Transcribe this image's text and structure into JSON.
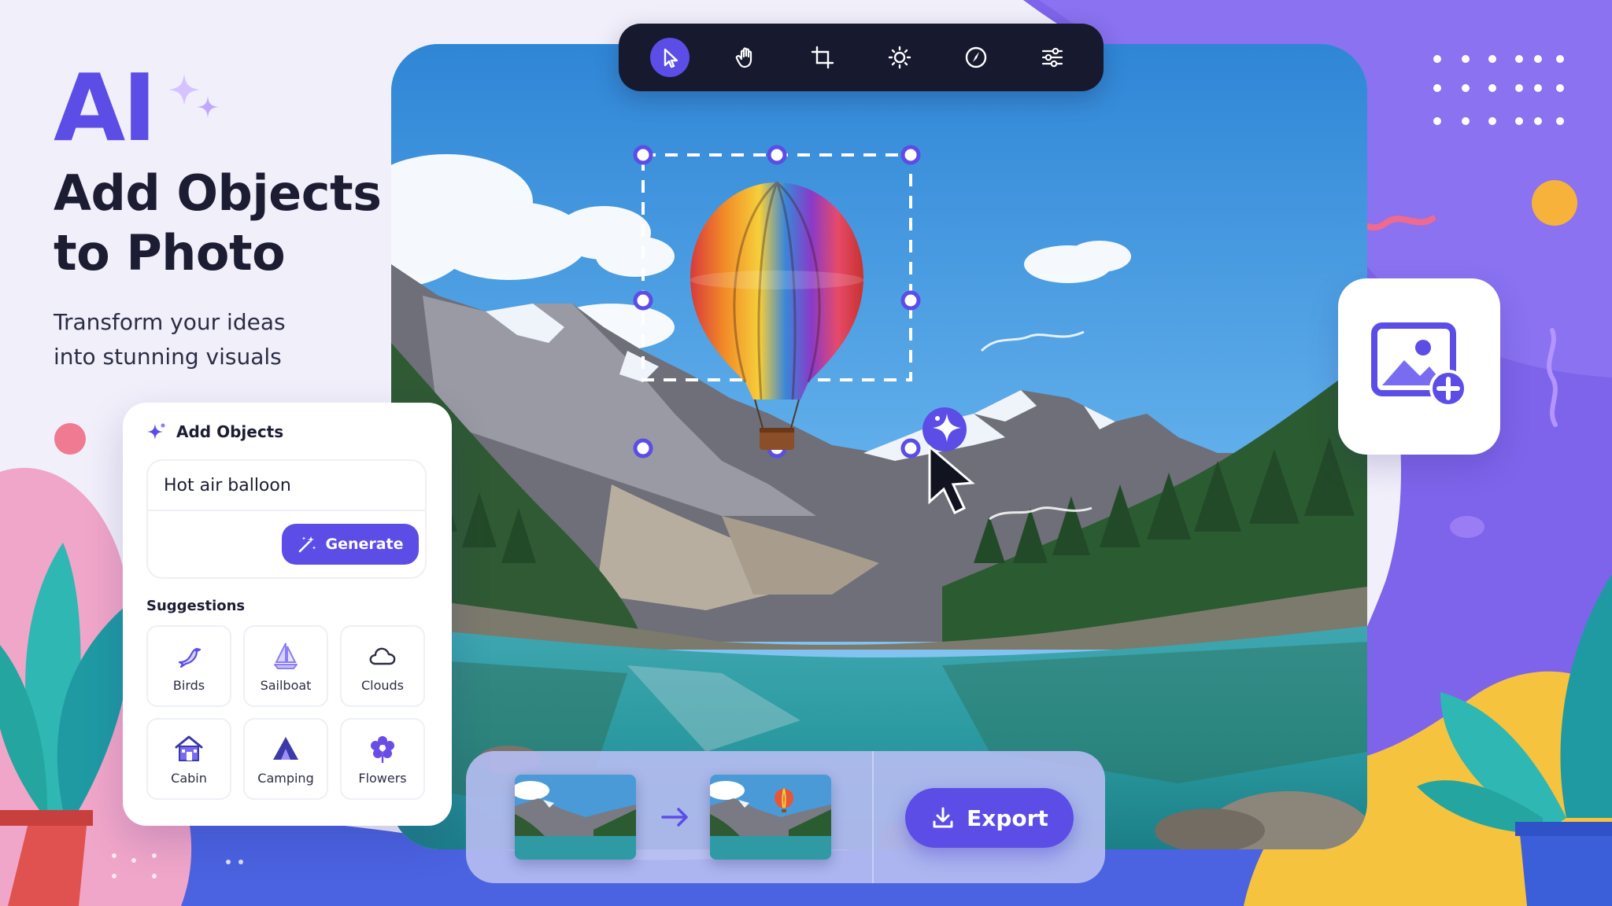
{
  "hero": {
    "ai": "AI",
    "title_line1": "Add Objects",
    "title_line2": "to Photo",
    "subtitle_line1": "Transform your ideas",
    "subtitle_line2": "into stunning visuals"
  },
  "toolbar": {
    "tools": [
      {
        "icon": "pointer-icon",
        "active": true
      },
      {
        "icon": "hand-icon",
        "active": false
      },
      {
        "icon": "crop-icon",
        "active": false
      },
      {
        "icon": "brightness-icon",
        "active": false
      },
      {
        "icon": "compass-icon",
        "active": false
      },
      {
        "icon": "sliders-icon",
        "active": false
      }
    ]
  },
  "panel": {
    "title": "Add Objects",
    "prompt_value": "Hot air balloon",
    "generate_label": "Generate",
    "suggestions_title": "Suggestions",
    "suggestions": [
      {
        "label": "Birds",
        "icon": "bird-icon"
      },
      {
        "label": "Sailboat",
        "icon": "sailboat-icon"
      },
      {
        "label": "Clouds",
        "icon": "cloud-icon"
      },
      {
        "label": "Cabin",
        "icon": "cabin-icon"
      },
      {
        "label": "Camping",
        "icon": "tent-icon"
      },
      {
        "label": "Flowers",
        "icon": "flower-icon"
      }
    ]
  },
  "strip": {
    "export_label": "Export"
  },
  "colors": {
    "accent": "#5b4de6",
    "dark": "#1c1d33",
    "toolbar_bg": "#171a2e"
  }
}
